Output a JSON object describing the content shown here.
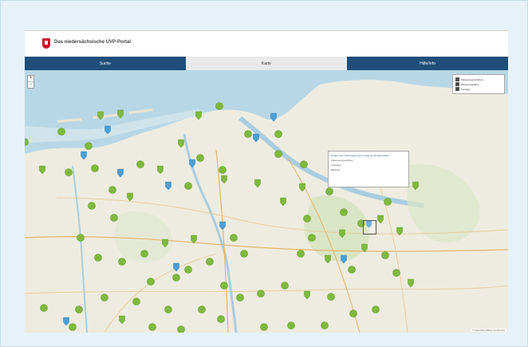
{
  "header": {
    "title": "Das niedersächsische UVP-Portal"
  },
  "nav": {
    "tabs": [
      {
        "label": "Suche",
        "active": false
      },
      {
        "label": "Karte",
        "active": true
      },
      {
        "label": "Hilfe/Info",
        "active": false
      }
    ]
  },
  "map": {
    "zoom_in": "+",
    "zoom_out": "−",
    "layers": [
      {
        "label": "Zulassungsverfahren",
        "checked": true
      },
      {
        "label": "Bebauungspläne",
        "checked": true
      },
      {
        "label": "Sonstige",
        "checked": true
      }
    ],
    "popup": {
      "lines": [
        "Neubau der Ortsumgehung im Zuge der Bundesstraße",
        "Zulassungsverfahren",
        "Vorhaben",
        "Behörde"
      ]
    },
    "attribution": "© OpenStreetMap contributors",
    "colors": {
      "green_marker": "#7fb93e",
      "blue_marker": "#4a9fd8",
      "water": "#b8d7e6",
      "land": "#eeece0"
    }
  }
}
